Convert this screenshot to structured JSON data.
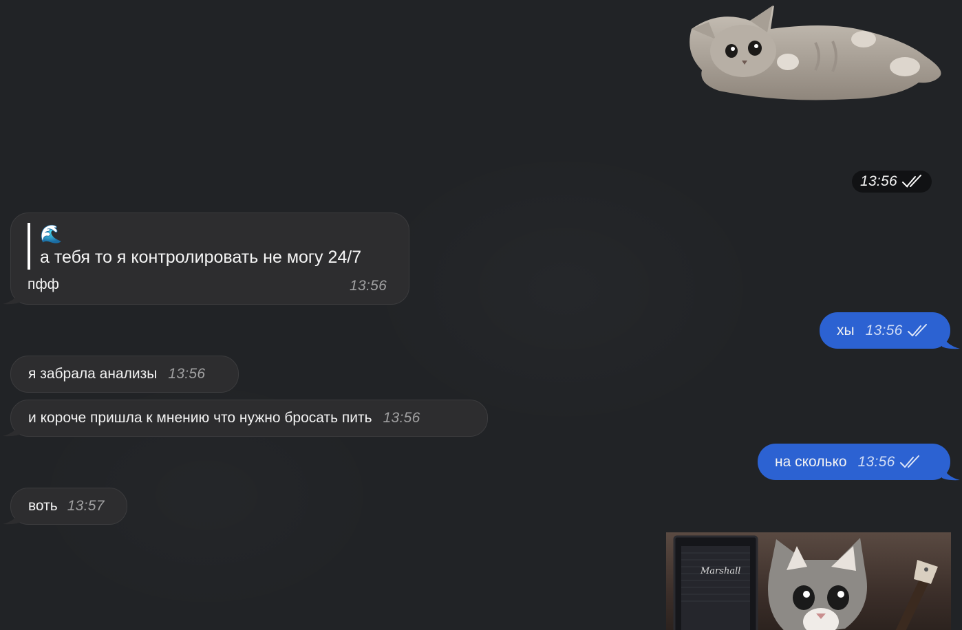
{
  "sticker": {
    "icon": "cat-lying-sticker",
    "time": "13:56",
    "status": "read-double-check"
  },
  "messages": [
    {
      "direction": "incoming",
      "reply_quote": {
        "icon": "wave-emoji",
        "emoji": "🌊",
        "text": "а тебя то я контролировать не могу 24/7"
      },
      "text": "пфф",
      "time": "13:56"
    },
    {
      "direction": "outgoing",
      "text": "хы",
      "time": "13:56",
      "status": "read-double-check"
    },
    {
      "direction": "incoming",
      "text": "я забрала анализы",
      "time": "13:56"
    },
    {
      "direction": "incoming",
      "text": "и короче пришла к мнению что нужно бросать пить",
      "time": "13:56"
    },
    {
      "direction": "outgoing",
      "text": "на сколько",
      "time": "13:56",
      "status": "read-double-check"
    },
    {
      "direction": "incoming",
      "text": "воть",
      "time": "13:57"
    }
  ],
  "gif": {
    "icon": "kitten-guitar-gif",
    "amp_brand": "Marshall"
  },
  "colors": {
    "background": "#212326",
    "incoming_bubble": "#2d2d2f",
    "outgoing_bubble": "#2c62d2",
    "time_pill": "#111214"
  }
}
